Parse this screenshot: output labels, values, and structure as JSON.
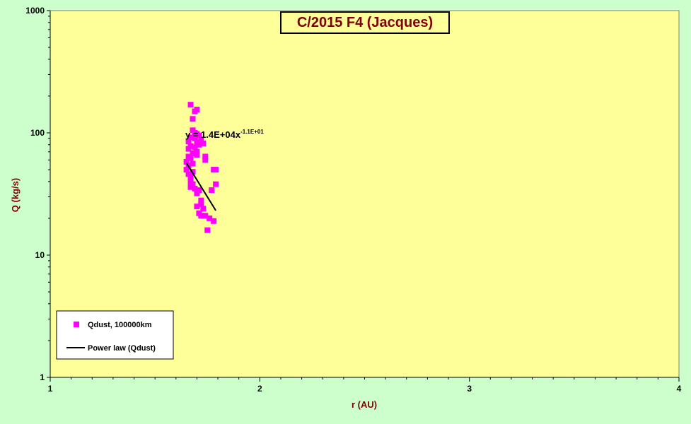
{
  "chart_data": {
    "type": "scatter",
    "title": "C/2015 F4 (Jacques)",
    "xlabel": "r (AU)",
    "ylabel": "Q (kg/s)",
    "xlim": [
      1,
      4
    ],
    "ylim": [
      1,
      1000
    ],
    "y_scale": "log",
    "x_ticks": [
      "1",
      "2",
      "3",
      "4"
    ],
    "y_ticks": [
      "1",
      "10",
      "100",
      "1000"
    ],
    "grid": false,
    "legend_position": "bottom-left",
    "plot_background": "#ffff99",
    "page_background": "#ccffcc",
    "series": [
      {
        "name": "Qdust, 100000km",
        "marker_color": "#ff00ff",
        "points": [
          [
            1.67,
            170
          ],
          [
            1.69,
            150
          ],
          [
            1.7,
            155
          ],
          [
            1.68,
            130
          ],
          [
            1.68,
            105
          ],
          [
            1.69,
            100
          ],
          [
            1.7,
            98
          ],
          [
            1.71,
            95
          ],
          [
            1.67,
            92
          ],
          [
            1.69,
            90
          ],
          [
            1.72,
            88
          ],
          [
            1.66,
            85
          ],
          [
            1.7,
            84
          ],
          [
            1.73,
            82
          ],
          [
            1.71,
            80
          ],
          [
            1.67,
            78
          ],
          [
            1.69,
            76
          ],
          [
            1.66,
            74
          ],
          [
            1.7,
            70
          ],
          [
            1.68,
            68
          ],
          [
            1.7,
            66
          ],
          [
            1.66,
            64
          ],
          [
            1.74,
            64
          ],
          [
            1.67,
            62
          ],
          [
            1.74,
            60
          ],
          [
            1.65,
            58
          ],
          [
            1.68,
            56
          ],
          [
            1.66,
            54
          ],
          [
            1.65,
            50
          ],
          [
            1.68,
            48
          ],
          [
            1.66,
            46
          ],
          [
            1.67,
            44
          ],
          [
            1.78,
            50
          ],
          [
            1.79,
            50
          ],
          [
            1.67,
            40
          ],
          [
            1.68,
            38
          ],
          [
            1.79,
            38
          ],
          [
            1.67,
            36
          ],
          [
            1.69,
            35
          ],
          [
            1.71,
            34
          ],
          [
            1.77,
            34
          ],
          [
            1.7,
            32
          ],
          [
            1.72,
            28
          ],
          [
            1.72,
            26
          ],
          [
            1.7,
            25
          ],
          [
            1.73,
            24
          ],
          [
            1.71,
            22
          ],
          [
            1.72,
            21
          ],
          [
            1.74,
            21
          ],
          [
            1.76,
            20
          ],
          [
            1.78,
            19
          ],
          [
            1.75,
            16
          ]
        ]
      },
      {
        "name": "Power law (Qdust)",
        "line_color": "#000000",
        "fit": {
          "a": 14000,
          "b": -11,
          "x_range": [
            1.65,
            1.79
          ]
        }
      }
    ],
    "annotation": {
      "base": "y = 1.4E+04x",
      "exponent": "-1.1E+01"
    }
  }
}
